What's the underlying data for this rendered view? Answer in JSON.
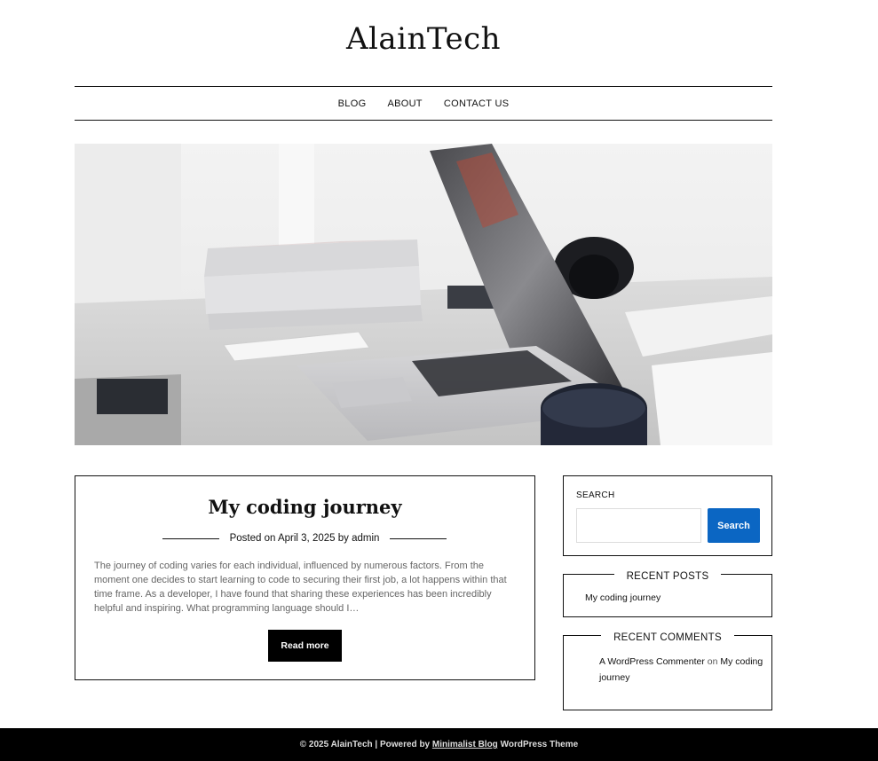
{
  "site": {
    "title": "AlainTech"
  },
  "nav": {
    "items": [
      {
        "label": "BLOG"
      },
      {
        "label": "ABOUT"
      },
      {
        "label": "CONTACT US"
      }
    ]
  },
  "post": {
    "title": "My coding journey",
    "meta_prefix": "Posted on",
    "date": "April 3, 2025",
    "meta_by": "by",
    "author": "admin",
    "excerpt": "The journey of coding varies for each individual, influenced by numerous factors. From the moment one decides to start learning to code to securing their first job, a lot happens within that time frame. As a developer, I have found that sharing these experiences has been incredibly helpful and inspiring. What programming language should I…",
    "read_more": "Read more"
  },
  "sidebar": {
    "search": {
      "label": "SEARCH",
      "input_value": "",
      "button": "Search"
    },
    "recent_posts": {
      "title": "RECENT POSTS",
      "items": [
        {
          "label": "My coding journey"
        }
      ]
    },
    "recent_comments": {
      "title": "RECENT COMMENTS",
      "items": [
        {
          "author": "A WordPress Commenter",
          "on": "on",
          "post": "My coding journey"
        }
      ]
    }
  },
  "footer": {
    "copyright": "© 2025 AlainTech | Powered by",
    "theme_link": "Minimalist Blog",
    "suffix": "WordPress Theme"
  },
  "colors": {
    "accent": "#0b66c3",
    "text": "#111111",
    "muted": "#666666",
    "footer_bg": "#000000"
  }
}
